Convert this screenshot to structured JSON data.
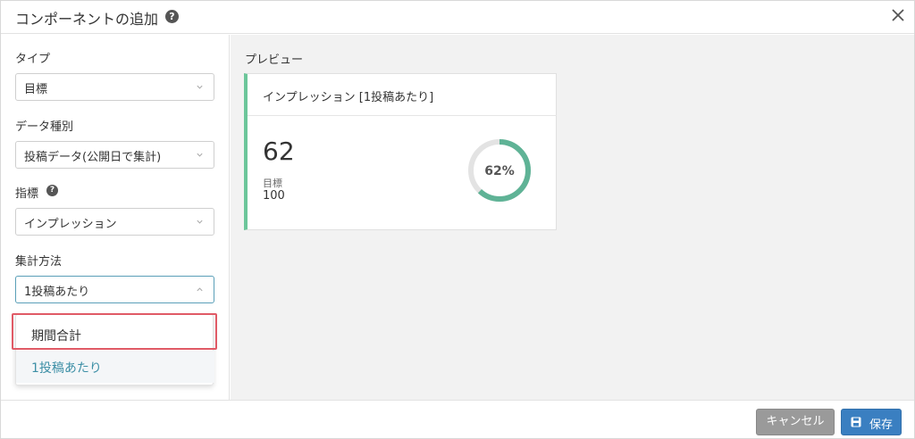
{
  "dialog": {
    "title": "コンポーネントの追加"
  },
  "form": {
    "type_label": "タイプ",
    "type_value": "目標",
    "data_kind_label": "データ種別",
    "data_kind_value": "投稿データ(公開日で集計)",
    "metric_label": "指標",
    "metric_value": "インプレッション",
    "aggregation_label": "集計方法",
    "aggregation_value": "1投稿あたり",
    "aggregation_options": [
      "期間合計",
      "1投稿あたり"
    ]
  },
  "preview": {
    "label": "プレビュー",
    "card_title": "インプレッション [1投稿あたり]",
    "value": "62",
    "goal_label": "目標",
    "goal_value": "100",
    "percent_text": "62%",
    "progress_fraction": 0.62
  },
  "footer": {
    "cancel_label": "キャンセル",
    "save_label": "保存"
  },
  "colors": {
    "accent_green": "#5fb396",
    "primary_blue": "#3a7fc1",
    "highlight_red": "#e05a66"
  }
}
